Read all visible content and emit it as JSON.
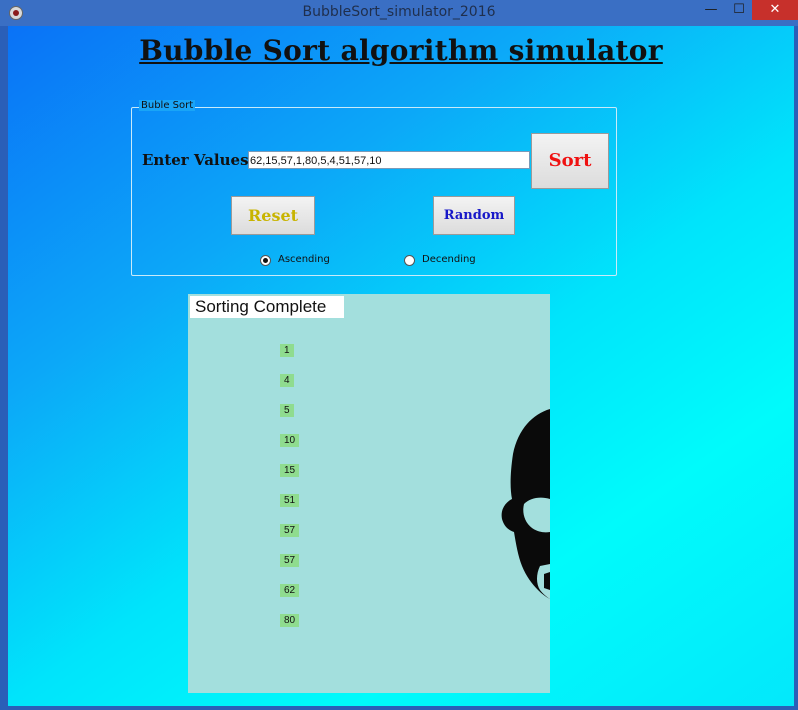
{
  "window": {
    "title": "BubbleSort_simulator_2016",
    "minimize": "—",
    "maximize": "☐",
    "close": "✕"
  },
  "heading": "Bubble Sort algorithm simulator",
  "group": {
    "legend": "Buble Sort",
    "enter_label": "Enter Values",
    "input_value": "62,15,57,1,80,5,4,51,57,10",
    "sort_label": "Sort",
    "reset_label": "Reset",
    "random_label": "Random",
    "order_options": [
      {
        "label": "Ascending",
        "selected": true
      },
      {
        "label": "Decending",
        "selected": false
      }
    ]
  },
  "result": {
    "status": "Sorting Complete",
    "sorted_values": [
      "1",
      "4",
      "5",
      "10",
      "15",
      "51",
      "57",
      "57",
      "62",
      "80"
    ]
  },
  "colors": {
    "sort_text": "#ef1111",
    "reset_text": "#c8b400",
    "random_text": "#1818c8",
    "panel_bg": "#a3dfdd",
    "value_bg": "#8fdc8f",
    "close_button": "#c7302b"
  },
  "icons": [
    "app-icon",
    "portrait-silhouette"
  ]
}
